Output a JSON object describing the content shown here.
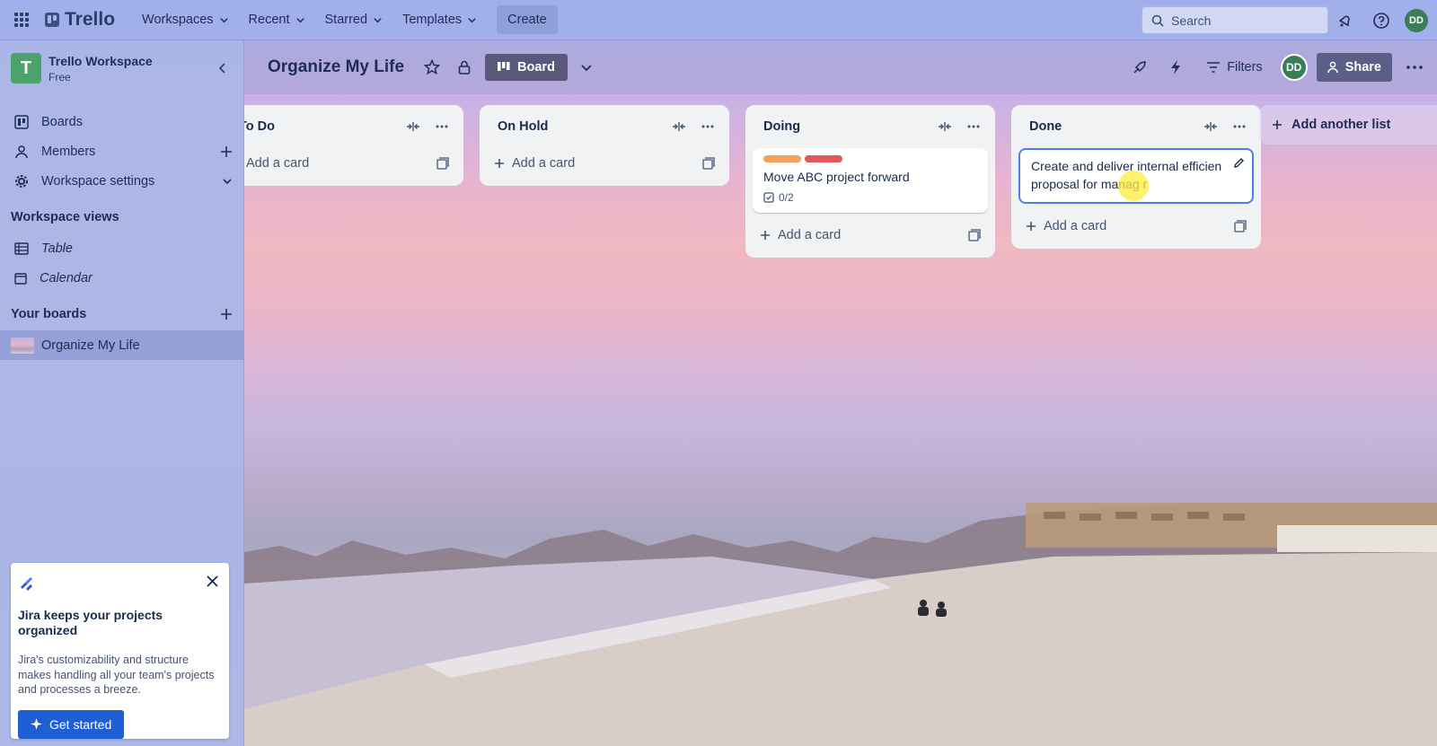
{
  "topbar": {
    "brand": "Trello",
    "menu": [
      "Workspaces",
      "Recent",
      "Starred",
      "Templates"
    ],
    "create_label": "Create",
    "search_placeholder": "Search",
    "avatar_initials": "DD"
  },
  "sidebar": {
    "workspace_initial": "T",
    "workspace_name": "Trello Workspace",
    "workspace_plan": "Free",
    "items": [
      {
        "label": "Boards"
      },
      {
        "label": "Members"
      },
      {
        "label": "Workspace settings"
      }
    ],
    "views_heading": "Workspace views",
    "views": [
      {
        "label": "Table"
      },
      {
        "label": "Calendar"
      }
    ],
    "boards_heading": "Your boards",
    "boards": [
      {
        "label": "Organize My Life"
      }
    ],
    "promo": {
      "title": "Jira keeps your projects organized",
      "body": "Jira's customizability and structure makes handling all your team's projects and processes a breeze.",
      "button": "Get started"
    }
  },
  "board": {
    "title": "Organize My Life",
    "view_label": "Board",
    "filters_label": "Filters",
    "share_label": "Share",
    "member_initials": "DD",
    "add_list_label": "Add another list",
    "lists": [
      {
        "title": "To Do",
        "add_label": "Add a card",
        "cards": []
      },
      {
        "title": "On Hold",
        "add_label": "Add a card",
        "cards": []
      },
      {
        "title": "Doing",
        "add_label": "Add a card",
        "cards": [
          {
            "title": "Move ABC project forward",
            "checklist": "0/2",
            "labels": [
              "#f5a35c",
              "#e2595a"
            ]
          }
        ]
      },
      {
        "title": "Done",
        "add_label": "Add a card",
        "cards": [
          {
            "title": "Create and deliver internal efficien proposal for manag r"
          }
        ]
      }
    ]
  },
  "colors": {
    "accent": "#1f5fd6",
    "label_orange": "#f5a35c",
    "label_red": "#e2595a",
    "workspace_tile": "#4aa36a",
    "avatar": "#3a7e57"
  }
}
